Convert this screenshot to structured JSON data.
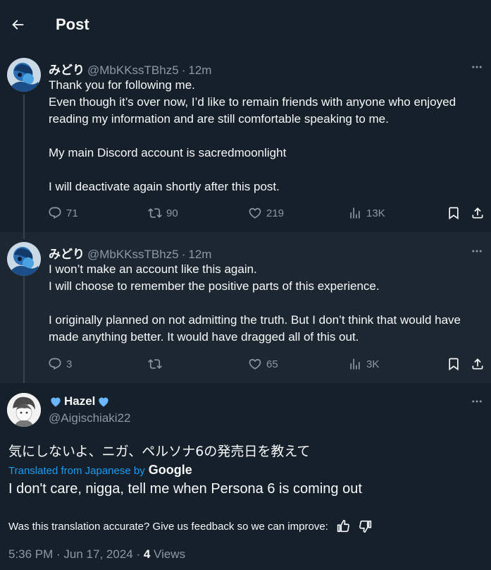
{
  "header": {
    "title": "Post",
    "back_icon": "arrow-left-icon"
  },
  "posts": [
    {
      "display_name": "みどり",
      "handle": "@MbKKssTBhz5",
      "separator": "·",
      "time": "12m",
      "lines": [
        "Thank you for following me.",
        "Even though it’s over now, I’d like to remain friends with anyone who enjoyed reading my information and are still comfortable speaking to me.",
        "",
        "My main Discord account is sacredmoonlight",
        "",
        "I will deactivate again shortly after this post."
      ],
      "stats": {
        "replies": "71",
        "reposts": "90",
        "likes": "219",
        "views": "13K"
      }
    },
    {
      "display_name": "みどり",
      "handle": "@MbKKssTBhz5",
      "separator": "·",
      "time": "12m",
      "lines": [
        "I won’t make an account like this again.",
        "I will choose to remember the positive parts of this experience.",
        "",
        "I originally planned on not admitting the truth. But I don’t think that would have made anything better. It would have dragged all of this out."
      ],
      "stats": {
        "replies": "3",
        "reposts": "",
        "likes": "65",
        "views": "3K"
      }
    }
  ],
  "reply": {
    "display_name": "Hazel",
    "handle": "@Aigischiaki22",
    "original_text": "気にしないよ、ニガ、ペルソナ6の発売日を教えて",
    "translated_from_label": "Translated from Japanese by",
    "translator_name": "Google",
    "translated_text": "I don't care, nigga, tell me when Persona 6 is coming out",
    "feedback_prompt": "Was this translation accurate? Give us feedback so we can improve:",
    "timestamp": "5:36 PM · Jun 17, 2024 · ",
    "views_count": "4",
    "views_label": " Views"
  },
  "colors": {
    "background": "#15202b",
    "highlight_background": "#1c2732",
    "text_primary": "#f7f9f9",
    "text_secondary": "#8b98a5",
    "link": "#1d9bf0",
    "heart": "#6ab7ff"
  }
}
